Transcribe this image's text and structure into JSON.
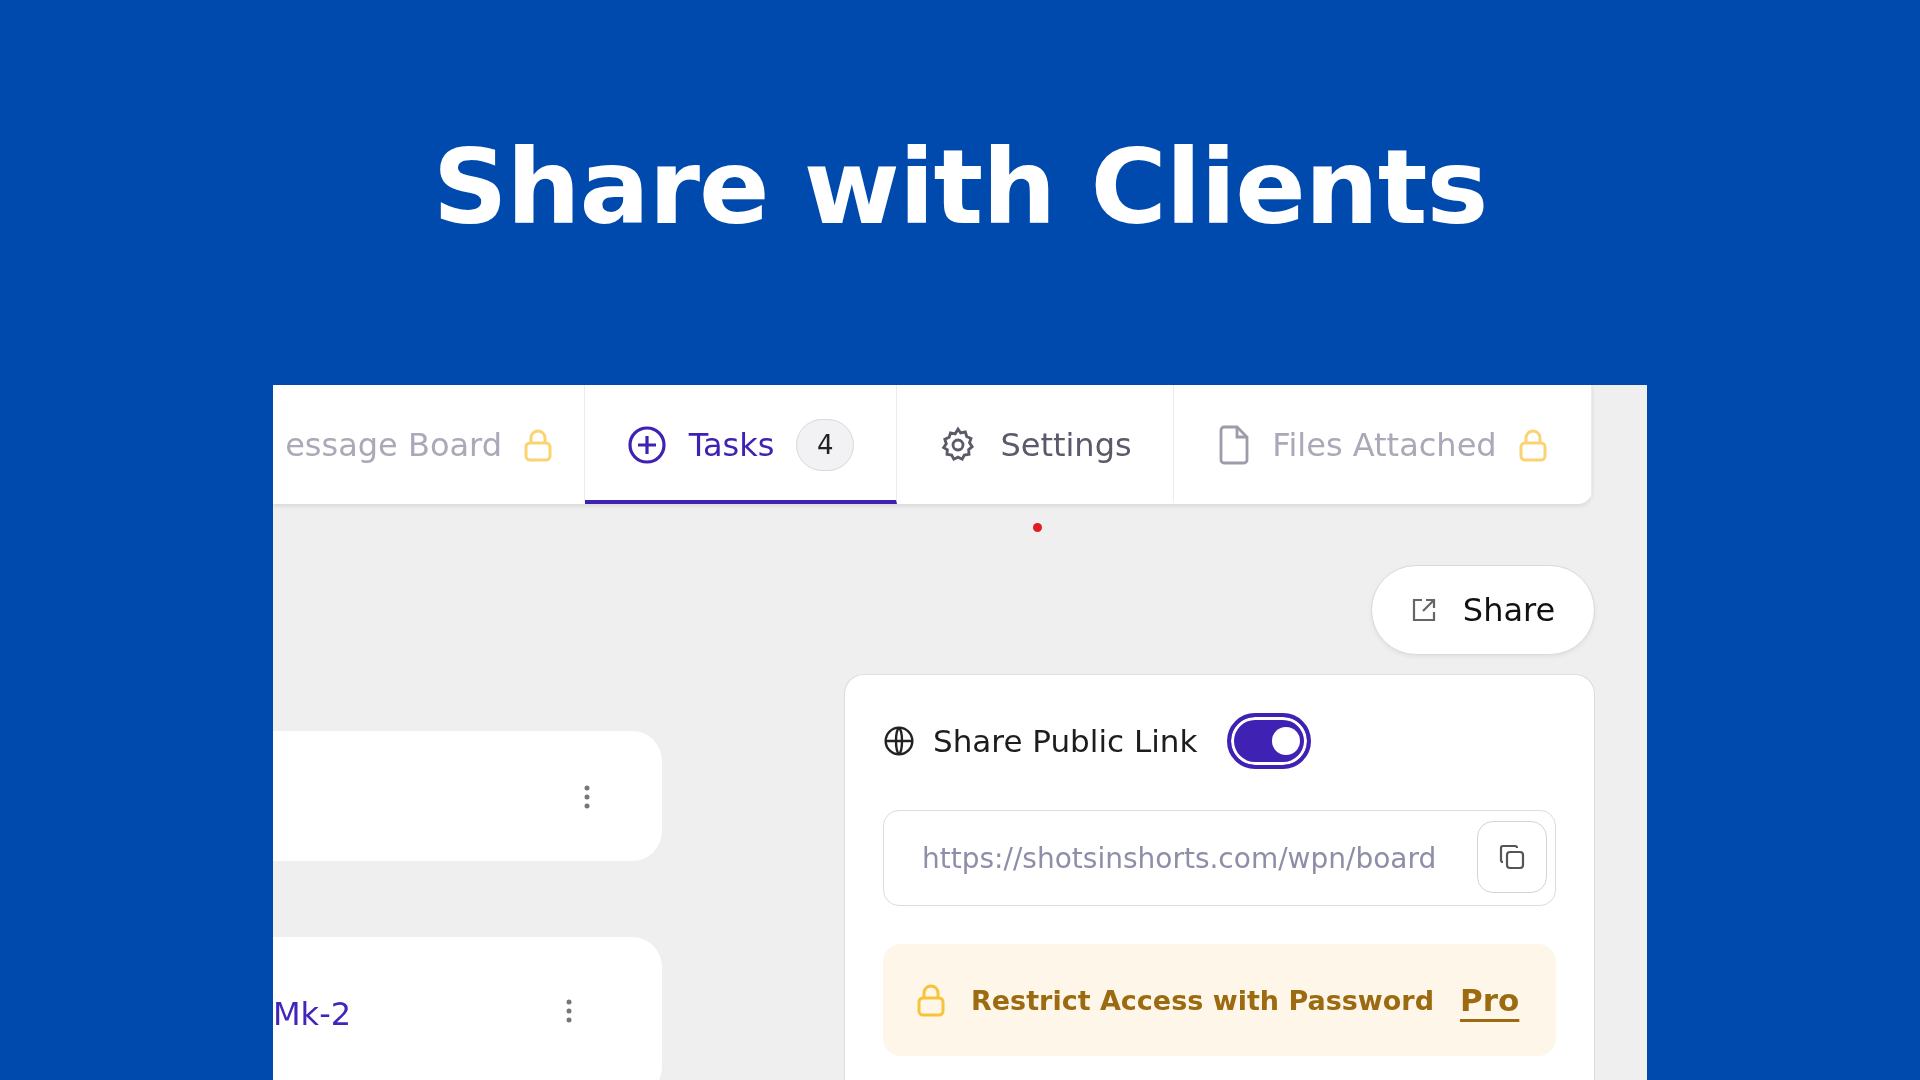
{
  "headline": "Share with Clients",
  "tabs": [
    {
      "label": "essage Board",
      "kind": "plain",
      "locked": true,
      "selected": false
    },
    {
      "label": "Tasks",
      "kind": "plus",
      "locked": false,
      "selected": true,
      "count": "4"
    },
    {
      "label": "Settings",
      "kind": "gear",
      "locked": false,
      "selected": false
    },
    {
      "label": "Files Attached",
      "kind": "file",
      "locked": true,
      "selected": false
    }
  ],
  "cards": [
    {
      "kind": "blank"
    },
    {
      "kind": "titled",
      "title": "Mk-2"
    }
  ],
  "share_button": "Share",
  "share_panel": {
    "public_link": {
      "label": "Share Public Link",
      "on": true
    },
    "url": "https://shotsinshorts.com/wpn/board",
    "restrict": {
      "label": "Restrict Access with Password",
      "badge": "Pro"
    }
  }
}
